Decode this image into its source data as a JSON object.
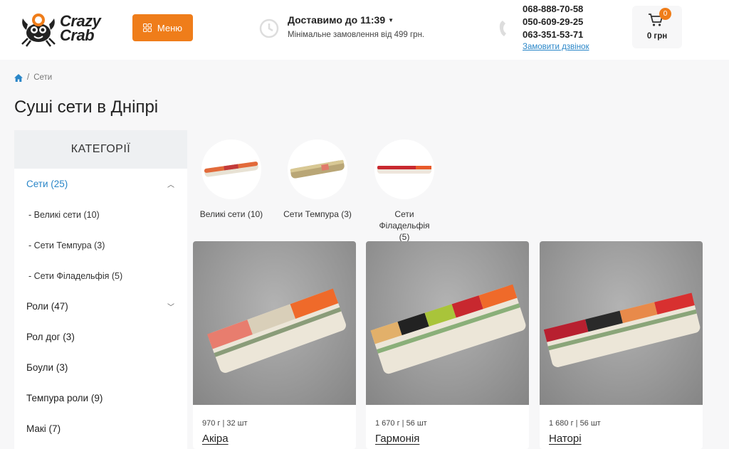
{
  "header": {
    "logo_text_line1": "Crazy",
    "logo_text_line2": "Crab",
    "menu_label": "Меню",
    "delivery_title": "Доставимо до 11:39",
    "delivery_sub": "Мінімальне замовлення від 499 грн.",
    "phones": [
      "068-888-70-58",
      "050-609-29-25",
      "063-351-53-71"
    ],
    "callback_label": "Замовити дзвінок",
    "cart_count": "0",
    "cart_total": "0 грн"
  },
  "breadcrumb": {
    "current": "Сети"
  },
  "page_title": "Суші сети в Дніпрі",
  "sidebar": {
    "header": "КАТЕГОРІЇ",
    "items": [
      {
        "label": "Сети (25)",
        "active": true
      },
      {
        "label": "- Великі сети (10)",
        "sub": true
      },
      {
        "label": "- Сети Темпура (3)",
        "sub": true
      },
      {
        "label": "- Сети Філадельфія (5)",
        "sub": true
      },
      {
        "label": "Роли (47)"
      },
      {
        "label": "Рол дог (3)"
      },
      {
        "label": "Боули (3)"
      },
      {
        "label": "Темпура роли (9)"
      },
      {
        "label": "Макі (7)"
      }
    ]
  },
  "subcategories": [
    {
      "label": "Великі сети (10)"
    },
    {
      "label": "Сети Темпура (3)"
    },
    {
      "label": "Сети Філадельфія (5)"
    }
  ],
  "products": [
    {
      "meta": "970 г | 32 шт",
      "name": "Акіра"
    },
    {
      "meta": "1 670 г | 56 шт",
      "name": "Гармонія"
    },
    {
      "meta": "1 680 г | 56 шт",
      "name": "Наторі"
    }
  ],
  "colors": {
    "accent": "#ef7d1a",
    "link": "#2a86c8"
  }
}
